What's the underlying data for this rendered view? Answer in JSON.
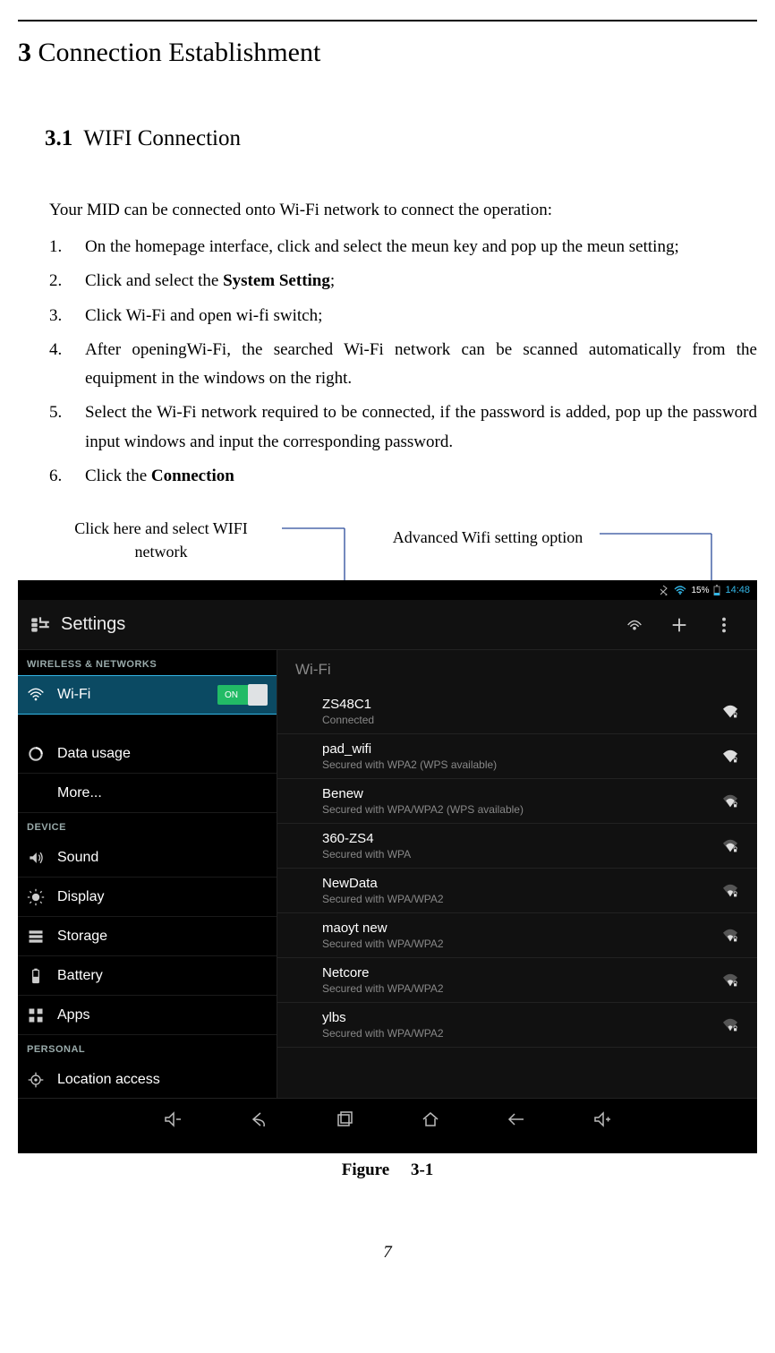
{
  "chapter": {
    "num": "3",
    "title": "Connection Establishment"
  },
  "section": {
    "num": "3.1",
    "title": "WIFI Connection"
  },
  "intro": "Your MID can be connected onto Wi-Fi network to connect the operation:",
  "steps": [
    {
      "n": "1.",
      "pre": "On the homepage interface, click and select the meun key and pop up the meun setting;",
      "bold": "",
      "post": ""
    },
    {
      "n": "2.",
      "pre": "Click and select the ",
      "bold": "System Setting",
      "post": ";"
    },
    {
      "n": "3.",
      "pre": "Click Wi-Fi and open wi-fi switch;",
      "bold": "",
      "post": ""
    },
    {
      "n": "4.",
      "pre": "After openingWi-Fi, the searched Wi-Fi network can be scanned automatically from the equipment in the windows on the right.",
      "bold": "",
      "post": ""
    },
    {
      "n": "5.",
      "pre": "Select the Wi-Fi network required to be connected, if the password is added, pop up the password input windows and input the corresponding password.",
      "bold": "",
      "post": ""
    },
    {
      "n": "6.",
      "pre": "Click the ",
      "bold": "Connection",
      "post": ""
    }
  ],
  "callout_left": "Click here and select WIFI network",
  "callout_right": "Advanced Wifi setting option",
  "screenshot": {
    "status": {
      "battery_pct": "15%",
      "time": "14:48"
    },
    "actionbar_title": "Settings",
    "section_wireless": "WIRELESS & NETWORKS",
    "section_device": "DEVICE",
    "section_personal": "PERSONAL",
    "wifi_label": "Wi-Fi",
    "wifi_switch": "ON",
    "left_items": [
      {
        "label": "Data usage"
      },
      {
        "label": "More..."
      }
    ],
    "device_items": [
      {
        "label": "Sound"
      },
      {
        "label": "Display"
      },
      {
        "label": "Storage"
      },
      {
        "label": "Battery"
      },
      {
        "label": "Apps"
      }
    ],
    "personal_items": [
      {
        "label": "Location access"
      }
    ],
    "right_title": "Wi-Fi",
    "networks": [
      {
        "name": "ZS48C1",
        "sub": "Connected"
      },
      {
        "name": "pad_wifi",
        "sub": "Secured with WPA2 (WPS available)"
      },
      {
        "name": "Benew",
        "sub": "Secured with WPA/WPA2 (WPS available)"
      },
      {
        "name": "360-ZS4",
        "sub": "Secured with WPA"
      },
      {
        "name": "NewData",
        "sub": "Secured with WPA/WPA2"
      },
      {
        "name": "maoyt new",
        "sub": "Secured with WPA/WPA2"
      },
      {
        "name": "Netcore",
        "sub": "Secured with WPA/WPA2"
      },
      {
        "name": "ylbs",
        "sub": "Secured with WPA/WPA2"
      }
    ]
  },
  "figure_caption": "Figure  3-1",
  "page_number": "7"
}
